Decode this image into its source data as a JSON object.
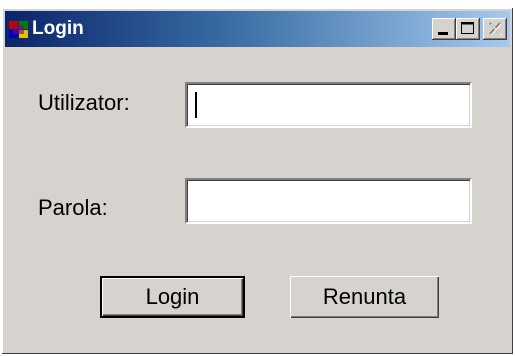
{
  "window": {
    "title": "Login",
    "icon": "app-icon",
    "controls": [
      "minimize-icon",
      "maximize-icon",
      "close-icon"
    ]
  },
  "form": {
    "username_label": "Utilizator:",
    "username_value": "",
    "password_label": "Parola:",
    "password_value": ""
  },
  "buttons": {
    "login_label": "Login",
    "cancel_label": "Renunta"
  },
  "colors": {
    "title_start": "#0a246a",
    "title_end": "#a6caf0",
    "face": "#d6d3ce"
  }
}
